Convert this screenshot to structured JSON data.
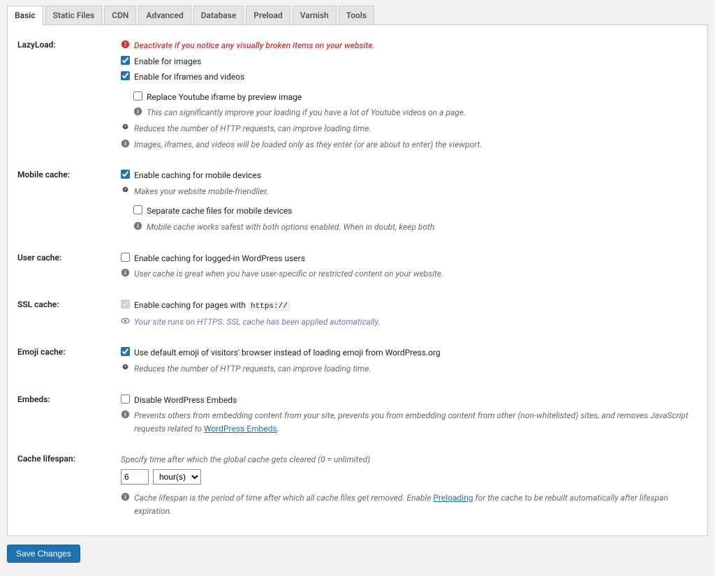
{
  "tabs": [
    "Basic",
    "Static Files",
    "CDN",
    "Advanced",
    "Database",
    "Preload",
    "Varnish",
    "Tools"
  ],
  "active_tab": 0,
  "lazyload": {
    "label": "LazyLoad:",
    "warning": "Deactivate if you notice any visually broken items on your website.",
    "enable_images": "Enable for images",
    "enable_iframes": "Enable for iframes and videos",
    "replace_youtube": "Replace Youtube iframe by preview image",
    "yt_desc": "This can significantly improve your loading if you have a lot of Youtube videos on a page.",
    "reduces": "Reduces the number of HTTP requests, can improve loading time.",
    "viewport": "Images, iframes, and videos will be loaded only as they enter (or are about to enter) the viewport."
  },
  "mobile": {
    "label": "Mobile cache:",
    "enable": "Enable caching for mobile devices",
    "friendlier": "Makes your website mobile-friendlier.",
    "separate": "Separate cache files for mobile devices",
    "safest": "Mobile cache works safest with both options enabled. When in doubt, keep both."
  },
  "user": {
    "label": "User cache:",
    "enable": "Enable caching for logged-in WordPress users",
    "desc": "User cache is great when you have user-specific or restricted content on your website."
  },
  "ssl": {
    "label": "SSL cache:",
    "enable_prefix": "Enable caching for pages with ",
    "enable_code": "https://",
    "desc": "Your site runs on HTTPS. SSL cache has been applied automatically."
  },
  "emoji": {
    "label": "Emoji cache:",
    "enable": "Use default emoji of visitors' browser instead of loading emoji from WordPress.org",
    "reduces": "Reduces the number of HTTP requests, can improve loading time."
  },
  "embeds": {
    "label": "Embeds:",
    "disable": "Disable WordPress Embeds",
    "desc_pre": "Prevents others from embedding content from your site, prevents you from embedding content from other (non-whitelisted) sites, and removes JavaScript requests related to ",
    "link": "WordPress Embeds",
    "desc_post": "."
  },
  "lifespan": {
    "label": "Cache lifespan:",
    "spec": "Specify time after which the global cache gets cleared (0 = unlimited)",
    "value": "6",
    "unit": "hour(s)",
    "desc_pre": "Cache lifespan is the period of time after which all cache files get removed. Enable ",
    "link": "Preloading",
    "desc_post": " for the cache to be rebuilt automatically after lifespan expiration."
  },
  "save": "Save Changes"
}
